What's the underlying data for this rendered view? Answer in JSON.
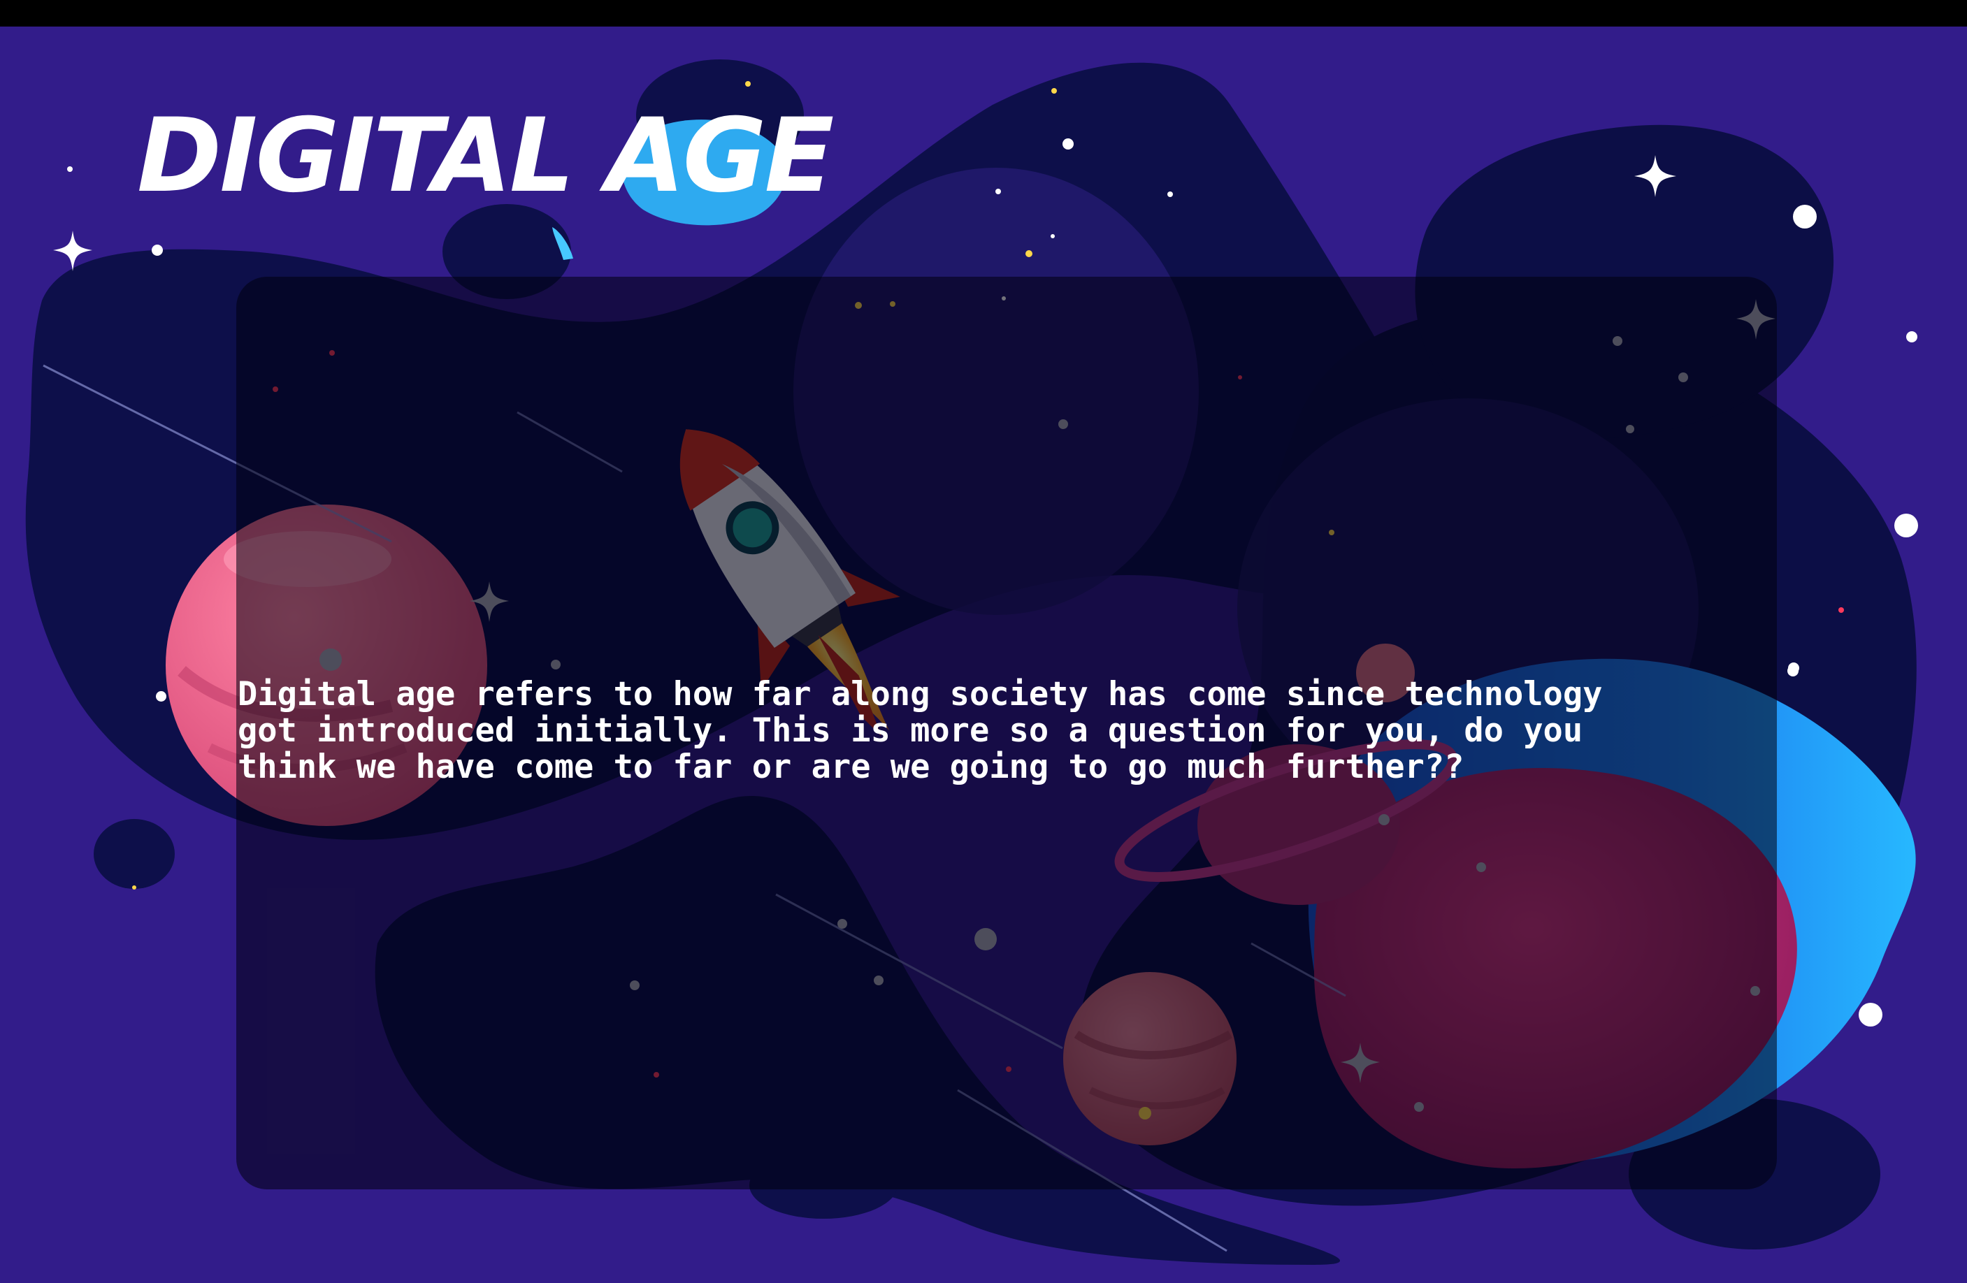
{
  "slide": {
    "title": "DIGITAL AGE",
    "bullets": [
      "Digital age refers to how far along society has come since technology\ngot introduced initially. This is more so a question for you, do you\nthink we have come to far or are we going to go much further??"
    ]
  },
  "theme": {
    "background": "#321c8a",
    "letterbox": "#000000",
    "blob_dark": "#0c0e46",
    "panel": "#06061c",
    "text": "#ffffff"
  },
  "icons": [
    "rocket-icon",
    "planet-icon",
    "ringed-planet-icon",
    "sparkle-icon",
    "shooting-star-icon"
  ]
}
